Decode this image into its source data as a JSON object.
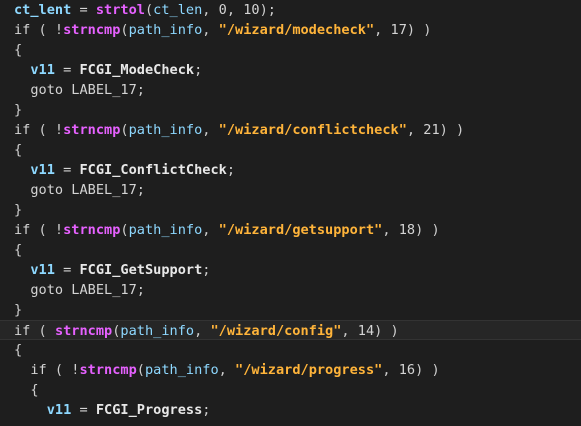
{
  "lines": [
    {
      "tokens": [
        [
          "ident",
          "ct_lent"
        ],
        [
          "op",
          " = "
        ],
        [
          "func",
          "strtol"
        ],
        [
          "punc",
          "("
        ],
        [
          "var",
          "ct_len"
        ],
        [
          "punc",
          ", "
        ],
        [
          "num",
          "0"
        ],
        [
          "punc",
          ", "
        ],
        [
          "num",
          "10"
        ],
        [
          "punc",
          ");"
        ]
      ]
    },
    {
      "tokens": [
        [
          "kw",
          "if"
        ],
        [
          "punc",
          " ( !"
        ],
        [
          "func",
          "strncmp"
        ],
        [
          "punc",
          "("
        ],
        [
          "var",
          "path_info"
        ],
        [
          "punc",
          ", "
        ],
        [
          "str",
          "\"/wizard/modecheck\""
        ],
        [
          "punc",
          ", "
        ],
        [
          "num",
          "17"
        ],
        [
          "punc",
          ") )"
        ]
      ]
    },
    {
      "tokens": [
        [
          "punc",
          "{"
        ]
      ]
    },
    {
      "tokens": [
        [
          "op",
          "  "
        ],
        [
          "ident",
          "v11"
        ],
        [
          "op",
          " = "
        ],
        [
          "fcgi",
          "FCGI_ModeCheck"
        ],
        [
          "punc",
          ";"
        ]
      ]
    },
    {
      "tokens": [
        [
          "op",
          "  "
        ],
        [
          "kw",
          "goto"
        ],
        [
          "label",
          " LABEL_17"
        ],
        [
          "punc",
          ";"
        ]
      ]
    },
    {
      "tokens": [
        [
          "punc",
          "}"
        ]
      ]
    },
    {
      "tokens": [
        [
          "kw",
          "if"
        ],
        [
          "punc",
          " ( !"
        ],
        [
          "func",
          "strncmp"
        ],
        [
          "punc",
          "("
        ],
        [
          "var",
          "path_info"
        ],
        [
          "punc",
          ", "
        ],
        [
          "str",
          "\"/wizard/conflictcheck\""
        ],
        [
          "punc",
          ", "
        ],
        [
          "num",
          "21"
        ],
        [
          "punc",
          ") )"
        ]
      ]
    },
    {
      "tokens": [
        [
          "punc",
          "{"
        ]
      ]
    },
    {
      "tokens": [
        [
          "op",
          "  "
        ],
        [
          "ident",
          "v11"
        ],
        [
          "op",
          " = "
        ],
        [
          "fcgi",
          "FCGI_ConflictCheck"
        ],
        [
          "punc",
          ";"
        ]
      ]
    },
    {
      "tokens": [
        [
          "op",
          "  "
        ],
        [
          "kw",
          "goto"
        ],
        [
          "label",
          " LABEL_17"
        ],
        [
          "punc",
          ";"
        ]
      ]
    },
    {
      "tokens": [
        [
          "punc",
          "}"
        ]
      ]
    },
    {
      "tokens": [
        [
          "kw",
          "if"
        ],
        [
          "punc",
          " ( !"
        ],
        [
          "func",
          "strncmp"
        ],
        [
          "punc",
          "("
        ],
        [
          "var",
          "path_info"
        ],
        [
          "punc",
          ", "
        ],
        [
          "str",
          "\"/wizard/getsupport\""
        ],
        [
          "punc",
          ", "
        ],
        [
          "num",
          "18"
        ],
        [
          "punc",
          ") )"
        ]
      ]
    },
    {
      "tokens": [
        [
          "punc",
          "{"
        ]
      ]
    },
    {
      "tokens": [
        [
          "op",
          "  "
        ],
        [
          "ident",
          "v11"
        ],
        [
          "op",
          " = "
        ],
        [
          "fcgi",
          "FCGI_GetSupport"
        ],
        [
          "punc",
          ";"
        ]
      ]
    },
    {
      "tokens": [
        [
          "op",
          "  "
        ],
        [
          "kw",
          "goto"
        ],
        [
          "label",
          " LABEL_17"
        ],
        [
          "punc",
          ";"
        ]
      ]
    },
    {
      "tokens": [
        [
          "punc",
          "}"
        ]
      ]
    },
    {
      "current": true,
      "tokens": [
        [
          "kw",
          "if"
        ],
        [
          "punc",
          " ( "
        ],
        [
          "func",
          "strncmp"
        ],
        [
          "punc",
          "("
        ],
        [
          "var",
          "path_info"
        ],
        [
          "punc",
          ", "
        ],
        [
          "str",
          "\"/wizard/config\""
        ],
        [
          "punc",
          ", "
        ],
        [
          "num",
          "14"
        ],
        [
          "punc",
          ") )"
        ]
      ]
    },
    {
      "tokens": [
        [
          "punc",
          "{"
        ]
      ]
    },
    {
      "tokens": [
        [
          "op",
          "  "
        ],
        [
          "kw",
          "if"
        ],
        [
          "punc",
          " ( !"
        ],
        [
          "func",
          "strncmp"
        ],
        [
          "punc",
          "("
        ],
        [
          "var",
          "path_info"
        ],
        [
          "punc",
          ", "
        ],
        [
          "str",
          "\"/wizard/progress\""
        ],
        [
          "punc",
          ", "
        ],
        [
          "num",
          "16"
        ],
        [
          "punc",
          ") )"
        ]
      ]
    },
    {
      "tokens": [
        [
          "op",
          "  "
        ],
        [
          "punc",
          "{"
        ]
      ]
    },
    {
      "tokens": [
        [
          "op",
          "    "
        ],
        [
          "ident",
          "v11"
        ],
        [
          "op",
          " = "
        ],
        [
          "fcgi",
          "FCGI_Progress"
        ],
        [
          "punc",
          ";"
        ]
      ]
    }
  ]
}
